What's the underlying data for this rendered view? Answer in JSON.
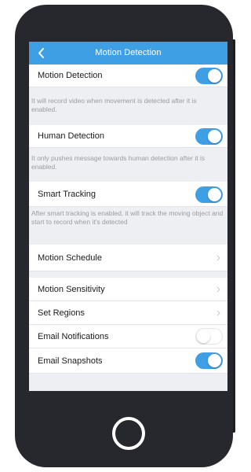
{
  "header": {
    "title": "Motion Detection",
    "back_icon": "chevron-left-icon"
  },
  "settings": {
    "motion_detection": {
      "label": "Motion Detection",
      "enabled": true,
      "description": "It will record video when movement is detected after it is enabled."
    },
    "human_detection": {
      "label": "Human Detection",
      "enabled": true,
      "description": "It only pushes message towards human detection after it is enabled."
    },
    "smart_tracking": {
      "label": "Smart Tracking",
      "enabled": true,
      "description": "After smart tracking is enabled, it will track the moving object and start to record when it's detected"
    },
    "motion_schedule": {
      "label": "Motion Schedule"
    },
    "motion_sensitivity": {
      "label": "Motion Sensitivity"
    },
    "set_regions": {
      "label": "Set Regions"
    },
    "email_notifications": {
      "label": "Email Notifications",
      "enabled": false
    },
    "email_snapshots": {
      "label": "Email Snapshots",
      "enabled": true
    }
  },
  "colors": {
    "accent": "#3e9fe5",
    "background": "#eeeff3",
    "phone_body": "#26282d"
  }
}
